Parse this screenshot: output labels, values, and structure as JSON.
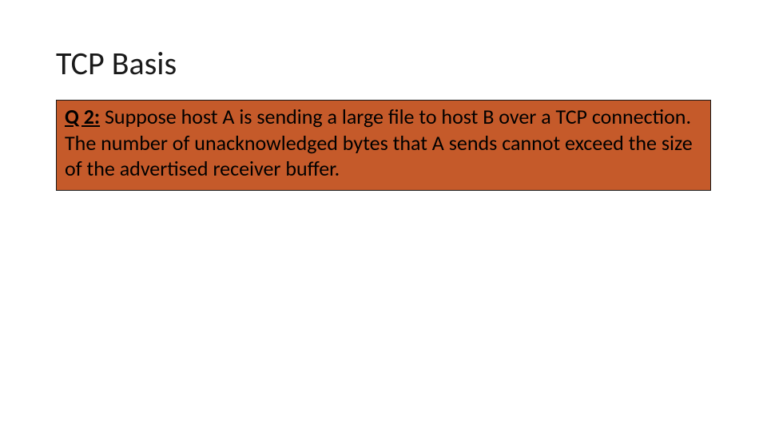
{
  "slide": {
    "title": "TCP Basis",
    "question": {
      "label": "Q 2:",
      "text": " Suppose host A is sending a large file to host B over a TCP connection. The number of unacknowledged bytes that A sends cannot exceed the size of the advertised receiver buffer."
    },
    "colors": {
      "box_bg": "#c55a2a",
      "box_border": "#1a1a1a"
    }
  }
}
